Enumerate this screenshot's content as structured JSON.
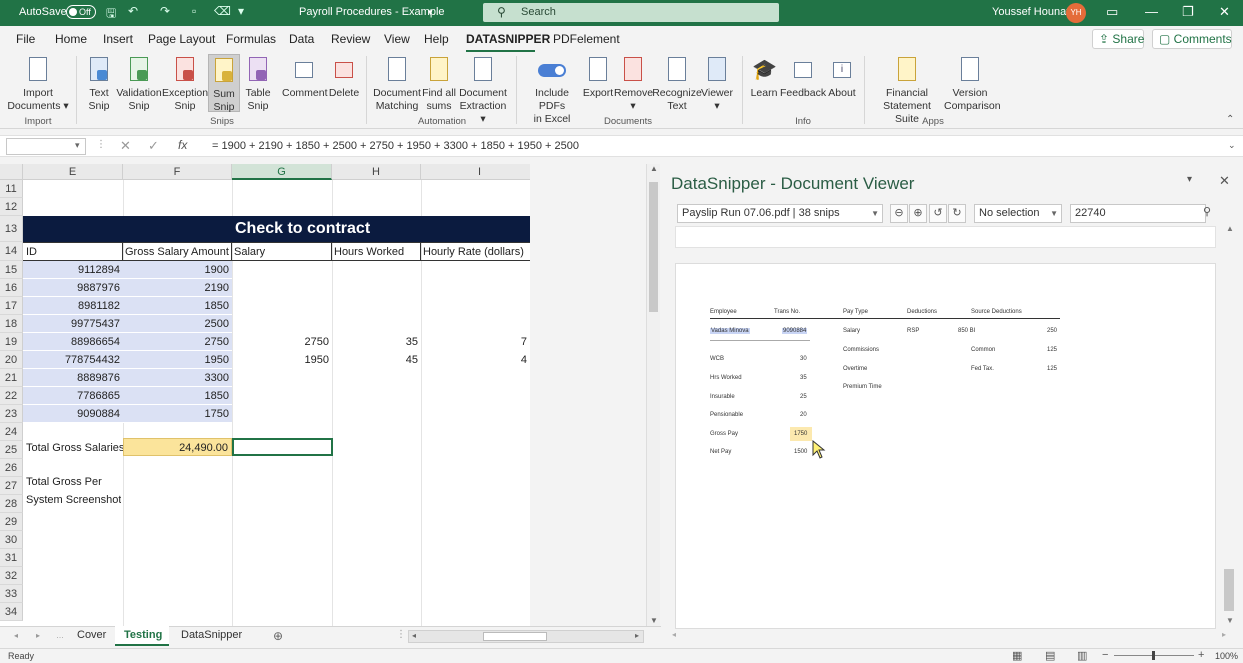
{
  "titlebar": {
    "autosave": "AutoSave",
    "autosave_state": "Off",
    "doc_title": "Payroll Procedures - Example",
    "search_placeholder": "Search",
    "user_name": "Youssef Hounat",
    "user_initials": "YH"
  },
  "menu": [
    "File",
    "Home",
    "Insert",
    "Page Layout",
    "Formulas",
    "Data",
    "Review",
    "View",
    "Help",
    "DATASNIPPER",
    "PDFelement"
  ],
  "share_label": "Share",
  "comments_label": "Comments",
  "ribbon": {
    "import": {
      "l1": "Import",
      "l2": "Documents"
    },
    "text_snip": {
      "l1": "Text",
      "l2": "Snip"
    },
    "validation_snip": {
      "l1": "Validation",
      "l2": "Snip"
    },
    "exception_snip": {
      "l1": "Exception",
      "l2": "Snip"
    },
    "sum_snip": {
      "l1": "Sum",
      "l2": "Snip"
    },
    "table_snip": {
      "l1": "Table",
      "l2": "Snip"
    },
    "comment": "Comment",
    "delete": "Delete",
    "doc_matching": {
      "l1": "Document",
      "l2": "Matching"
    },
    "find_sums": {
      "l1": "Find all",
      "l2": "sums"
    },
    "doc_extraction": {
      "l1": "Document",
      "l2": "Extraction"
    },
    "include_pdfs": {
      "l1": "Include PDFs",
      "l2": "in Excel"
    },
    "export": "Export",
    "remove": "Remove",
    "recognize": {
      "l1": "Recognize",
      "l2": "Text"
    },
    "viewer": "Viewer",
    "learn": "Learn",
    "feedback": "Feedback",
    "about": "About",
    "financial": {
      "l1": "Financial",
      "l2": "Statement Suite"
    },
    "version": {
      "l1": "Version",
      "l2": "Comparison"
    },
    "groups": {
      "import": "Import",
      "snips": "Snips",
      "automation": "Automation",
      "documents": "Documents",
      "info": "Info",
      "apps": "Apps"
    }
  },
  "formula": "= 1900 + 2190 + 1850 + 2500 + 2750 + 1950 + 3300 + 1850 + 1950 + 2500",
  "columns": [
    "E",
    "F",
    "G",
    "H",
    "I"
  ],
  "rows": [
    "11",
    "12",
    "13",
    "14",
    "15",
    "16",
    "17",
    "18",
    "19",
    "20",
    "21",
    "22",
    "23",
    "24",
    "25",
    "26",
    "27",
    "28",
    "29",
    "30",
    "31",
    "32",
    "33",
    "34"
  ],
  "table": {
    "title": "Check to contract",
    "headers": [
      "ID",
      "Gross Salary Amount",
      "Salary",
      "Hours Worked",
      "Hourly Rate (dollars)"
    ],
    "ids": [
      "9112894",
      "9887976",
      "8981182",
      "99775437",
      "88986654",
      "778754432",
      "8889876",
      "7786865",
      "9090884"
    ],
    "gross": [
      "1900",
      "2190",
      "1850",
      "2500",
      "2750",
      "1950",
      "3300",
      "1850",
      "1750"
    ],
    "salary_r19": "2750",
    "hours_r19": "35",
    "rate_r19": "7",
    "salary_r20": "1950",
    "hours_r20": "45",
    "rate_r20": "4",
    "total_label": "Total Gross Salaries",
    "total_value": "24,490.00",
    "label_26": "Total Gross Per",
    "label_27": "System Screenshot"
  },
  "viewer": {
    "title": "DataSnipper - Document Viewer",
    "doc_select": "Payslip Run 07.06.pdf | 38 snips",
    "selection": "No selection",
    "search_value": "22740",
    "payslip": {
      "headers": [
        "Employee",
        "Trans No.",
        "Pay Type",
        "Deductions",
        "Source Deductions"
      ],
      "employee": "Vadas Minova",
      "trans_no": "9090884",
      "left_labels": [
        "WCB",
        "Hrs Worked",
        "Insurable",
        "Pensionable",
        "Gross Pay",
        "Net Pay"
      ],
      "left_values": [
        "30",
        "35",
        "25",
        "20",
        "1750",
        "1500"
      ],
      "pay_types": [
        "Salary",
        "Commissions",
        "Overtime",
        "Premium Time"
      ],
      "deduction": "RSP",
      "deduction_val": "850 BI",
      "source": [
        "Common",
        "Fed Tax."
      ],
      "source_vals": [
        "250",
        "125",
        "125"
      ]
    }
  },
  "sheet_tabs": [
    "Cover",
    "Testing",
    "DataSnipper"
  ],
  "status": {
    "ready": "Ready",
    "zoom": "100%"
  }
}
